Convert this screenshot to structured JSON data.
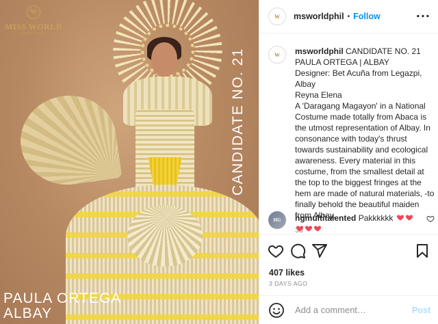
{
  "colors": {
    "accent": "#0095f6",
    "post_disabled": "#b2dffc",
    "muted": "#8e8e8e",
    "text": "#262626",
    "heart": "#ed4956",
    "brand_gold": "#c8a15a"
  },
  "photo": {
    "brand_wordmark": "MISS WORLD",
    "brand_tagline": "PHILIPPINES",
    "candidate_label": "CANDIDATE NO. 21",
    "name_line1": "PAULA ORTEGA",
    "name_line2": "ALBAY"
  },
  "header": {
    "avatar_icon": "misswordphil-avatar-icon",
    "username": "msworldphil",
    "separator": "•",
    "follow_label": "Follow",
    "more_icon": "more-options-icon"
  },
  "caption": {
    "username": "msworldphil",
    "title": "CANDIDATE NO. 21 PAULA ORTEGA | ALBAY",
    "designer": "Designer: Bet Acuña from Legazpi, Albay",
    "line2": "Reyna Elena",
    "body": "A 'Daragang Magayon' in a National Costume made totally from Abaca is the utmost representation of Albay. In consonance with today's thrust towards sustainability and ecological awareness. Every material in this costume, from the smallest detail at the top to the biggest fringes at the hem are made of natural materials, -to finally behold the beautiful maiden from Albay.",
    "age": "3d"
  },
  "comment": {
    "username": "hgmultitalented",
    "text": "Pakkkkkk",
    "heart_count": 5,
    "heart_icon": "heart-emoji-icon"
  },
  "actions": {
    "icons": [
      "heart-icon",
      "comment-icon",
      "share-icon",
      "bookmark-icon"
    ]
  },
  "likes": "407 likes",
  "date": "3 DAYS AGO",
  "add_comment": {
    "emoji_icon": "smiley-icon",
    "placeholder": "Add a comment…",
    "post_label": "Post"
  }
}
